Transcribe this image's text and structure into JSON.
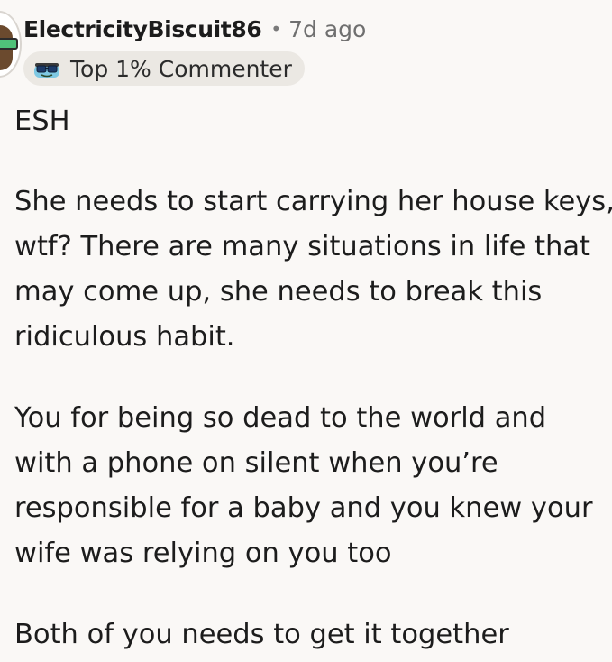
{
  "comment": {
    "username": "ElectricityBiscuit86",
    "separator": "•",
    "timestamp": "7d ago",
    "flair": {
      "icon": "sunglasses-icon",
      "label": "Top 1% Commenter"
    },
    "paragraphs": [
      {
        "lines": [
          "ESH"
        ]
      },
      {
        "lines": [
          "She needs to start carrying her house keys,",
          "wtf? There are many situations in life that",
          "may come up, she needs to break this",
          "ridiculous habit."
        ]
      },
      {
        "lines": [
          "You for being so dead to the world and",
          "with a phone on silent when you’re",
          "responsible for a baby and you knew your",
          "wife was relying on you too"
        ]
      },
      {
        "lines": [
          "Both of you needs to get it together"
        ]
      }
    ]
  },
  "colors": {
    "background": "#faf8f6",
    "text": "#1c1c1c",
    "muted": "#6f6f6f",
    "flair_bg": "#ebe8e3"
  }
}
